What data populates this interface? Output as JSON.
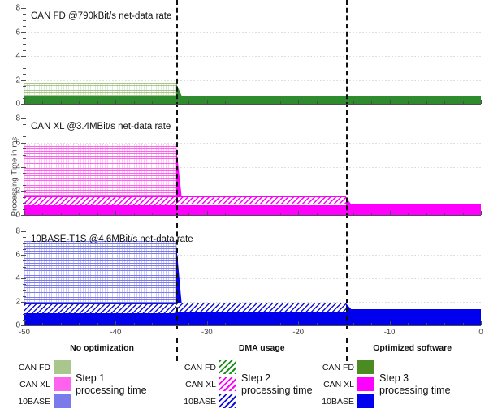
{
  "axes": {
    "ylabel": "Processing Time in ms",
    "ylim": [
      0,
      8
    ],
    "yticks": [
      0,
      2,
      4,
      6,
      8
    ],
    "xlim": [
      -50,
      0
    ],
    "xticks": [
      -50,
      -40,
      -30,
      -20,
      -10,
      0
    ],
    "xticklabels": [
      "-50",
      "-40",
      "-30",
      "-20",
      "-10",
      "0"
    ],
    "yticklabels": [
      "0",
      "2",
      "4",
      "6",
      "8"
    ],
    "grid": true
  },
  "phases": [
    {
      "label": "No optimization",
      "center": -41.5
    },
    {
      "label": "DMA usage",
      "center": -24.0
    },
    {
      "label": "Optimized software",
      "center": -7.5
    }
  ],
  "dividers": [
    -33.4,
    -14.8
  ],
  "legends": [
    {
      "id": "step-1",
      "step_label": "Step 1",
      "step_sub": "processing time",
      "rows": [
        {
          "name": "CAN FD",
          "swatch": "sw-s1-green"
        },
        {
          "name": "CAN XL",
          "swatch": "sw-s1-magenta"
        },
        {
          "name": "10BASE",
          "swatch": "sw-s1-blue"
        }
      ]
    },
    {
      "id": "step-2",
      "step_label": "Step 2",
      "step_sub": "processing time",
      "rows": [
        {
          "name": "CAN FD",
          "swatch": "sw-s2-green"
        },
        {
          "name": "CAN XL",
          "swatch": "sw-s2-magenta"
        },
        {
          "name": "10BASE",
          "swatch": "sw-s2-blue"
        }
      ]
    },
    {
      "id": "step-3",
      "step_label": "Step 3",
      "step_sub": "processing time",
      "rows": [
        {
          "name": "CAN FD",
          "swatch": "sw-s3-green"
        },
        {
          "name": "CAN XL",
          "swatch": "sw-s3-magenta"
        },
        {
          "name": "10BASE",
          "swatch": "sw-s3-blue"
        }
      ]
    }
  ],
  "chart_data": {
    "type": "area",
    "title": "",
    "xlabel": "",
    "ylabel": "Processing Time in ms",
    "xlim": [
      -50,
      0
    ],
    "ylim": [
      0,
      8
    ],
    "xticks": [
      -50,
      -40,
      -30,
      -20,
      -10,
      0
    ],
    "yticks": [
      0,
      2,
      4,
      6,
      8
    ],
    "grid": true,
    "legend_position": "bottom",
    "stacked": true,
    "phase_boundaries": [
      -33.4,
      -14.8
    ],
    "phases": [
      "No optimization",
      "DMA usage",
      "Optimized software"
    ],
    "panels": [
      {
        "title": "CAN FD @790kBit/s net-data rate",
        "bus": "CAN FD",
        "net_data_rate": "790kBit/s",
        "colors": {
          "step1": "#a9c68d",
          "step2": "#1f8f1f",
          "step3": "#2e8b2e"
        },
        "series": [
          {
            "name": "Step 3 processing time",
            "style": "solid",
            "values_by_phase": {
              "No optimization": 0.65,
              "DMA usage": 0.68,
              "Optimized software": 0.66
            }
          },
          {
            "name": "Step 2 processing time",
            "style": "hatch",
            "values_by_phase": {
              "No optimization": 0.0,
              "DMA usage": 0.0,
              "Optimized software": 0.0
            }
          },
          {
            "name": "Step 1 processing time",
            "style": "checker",
            "values_by_phase": {
              "No optimization": 1.1,
              "DMA usage": 0.0,
              "Optimized software": 0.0
            }
          }
        ],
        "cumulative_top_by_phase": {
          "No optimization": 1.75,
          "DMA usage": 0.68,
          "Optimized software": 0.66
        }
      },
      {
        "title": "CAN XL @3.4MBit/s net-data rate",
        "bus": "CAN XL",
        "net_data_rate": "3.4MBit/s",
        "colors": {
          "step1": "#ff63ee",
          "step2": "#ff00ff",
          "step3": "#ff00ff"
        },
        "series": [
          {
            "name": "Step 3 processing time",
            "style": "solid",
            "values_by_phase": {
              "No optimization": 0.82,
              "DMA usage": 0.84,
              "Optimized software": 0.85
            }
          },
          {
            "name": "Step 2 processing time",
            "style": "hatch",
            "values_by_phase": {
              "No optimization": 0.72,
              "DMA usage": 0.7,
              "Optimized software": 0.0
            }
          },
          {
            "name": "Step 1 processing time",
            "style": "checker",
            "values_by_phase": {
              "No optimization": 4.36,
              "DMA usage": 0.0,
              "Optimized software": 0.0
            }
          }
        ],
        "cumulative_top_by_phase": {
          "No optimization": 5.9,
          "DMA usage": 1.54,
          "Optimized software": 0.85
        }
      },
      {
        "title": "10BASE-T1S @4.6MBit/s net-data rate",
        "bus": "10BASE-T1S",
        "net_data_rate": "4.6MBit/s",
        "colors": {
          "step1": "#7a7aea",
          "step2": "#1414d8",
          "step3": "#0000ee"
        },
        "series": [
          {
            "name": "Step 3 processing time",
            "style": "solid",
            "values_by_phase": {
              "No optimization": 1.05,
              "DMA usage": 1.08,
              "Optimized software": 1.35
            }
          },
          {
            "name": "Step 2 processing time",
            "style": "hatch",
            "values_by_phase": {
              "No optimization": 0.8,
              "DMA usage": 0.82,
              "Optimized software": 0.0
            }
          },
          {
            "name": "Step 1 processing time",
            "style": "checker",
            "values_by_phase": {
              "No optimization": 5.35,
              "DMA usage": 0.0,
              "Optimized software": 0.0
            }
          }
        ],
        "cumulative_top_by_phase": {
          "No optimization": 7.2,
          "DMA usage": 1.9,
          "Optimized software": 1.35
        }
      }
    ]
  }
}
